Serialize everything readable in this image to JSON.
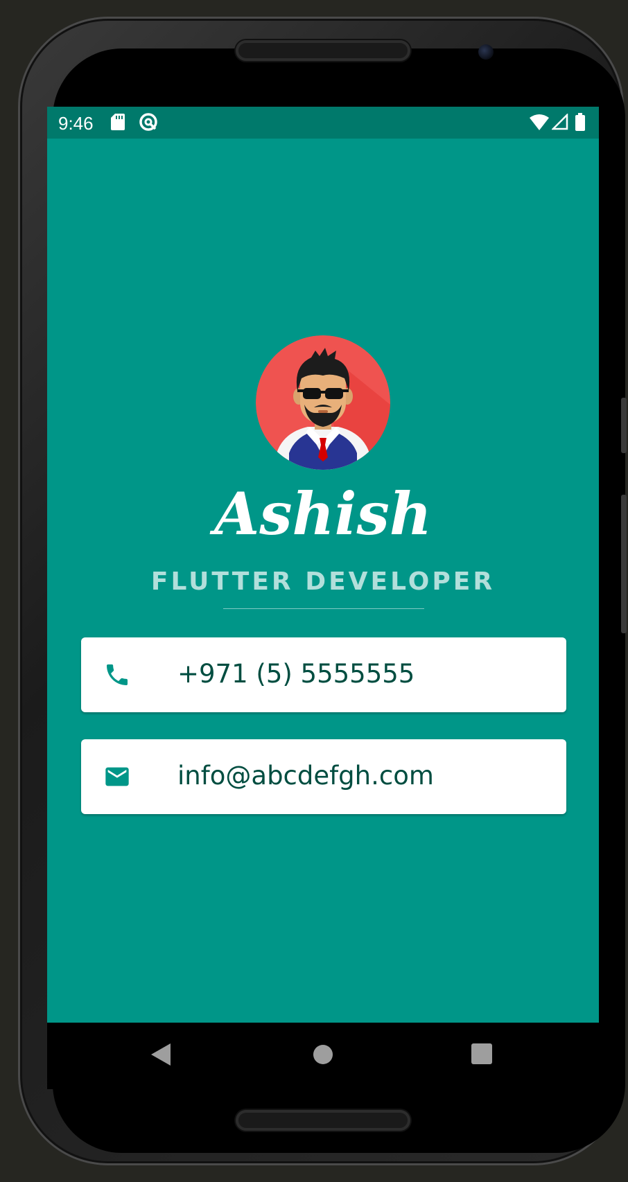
{
  "status_bar": {
    "time": "9:46",
    "left_icons": [
      "sd-card-icon",
      "sync-icon"
    ],
    "right_icons": [
      "wifi-icon",
      "signal-icon",
      "battery-icon"
    ]
  },
  "profile": {
    "avatar_icon": "avatar-icon",
    "name": "Ashish",
    "title": "FLUTTER DEVELOPER"
  },
  "contacts": [
    {
      "icon": "phone-icon",
      "text": "+971 (5) 5555555"
    },
    {
      "icon": "email-icon",
      "text": "info@abcdefgh.com"
    }
  ],
  "nav_bar": {
    "buttons": [
      "back-icon",
      "home-icon",
      "recents-icon"
    ]
  },
  "colors": {
    "background": "#009688",
    "status_bar": "#00796b",
    "card": "#ffffff",
    "card_text": "#004d40",
    "icon": "#009688",
    "title": "#b2dfdb",
    "avatar_bg": "#ef5350"
  }
}
